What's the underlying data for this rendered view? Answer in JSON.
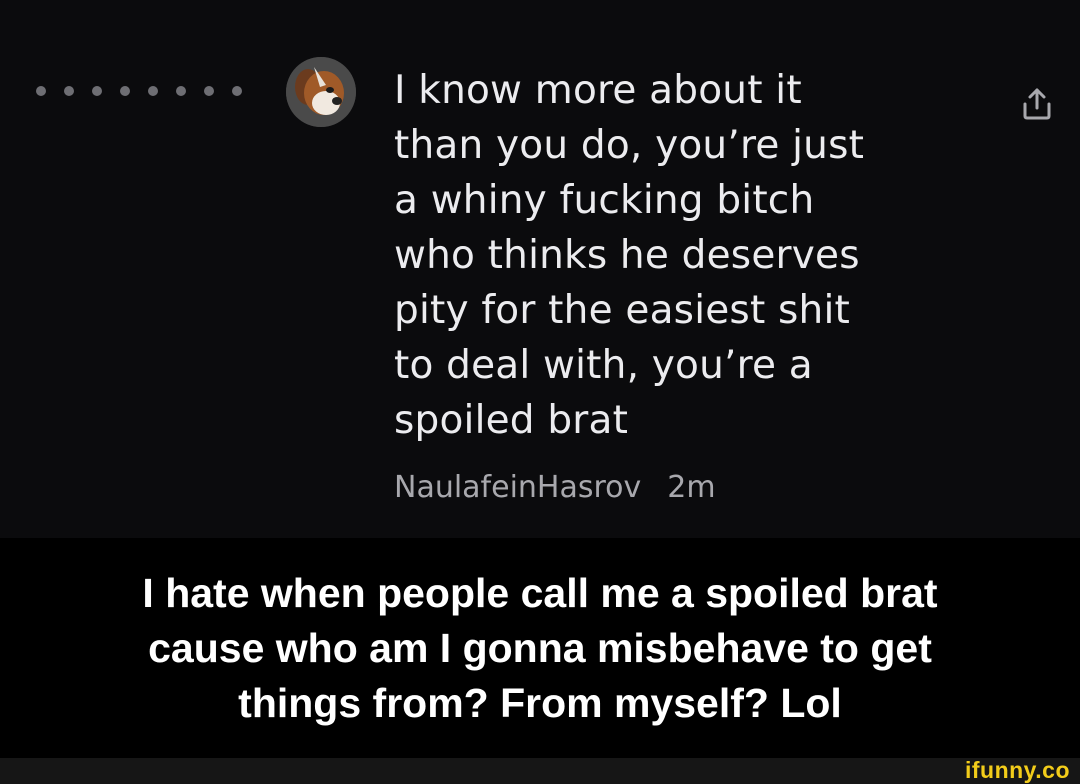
{
  "comment": {
    "lines": [
      "I know more about it",
      "than you do, you’re just",
      "a whiny fucking bitch",
      "who thinks he deserves",
      "pity for the easiest shit",
      "to deal with, you’re a",
      "spoiled brat"
    ],
    "username": "NaulafeinHasrov",
    "time": "2m",
    "avatar_icon": "dog-avatar-icon",
    "share_icon": "share-icon",
    "dots_icon": "thread-dots-icon"
  },
  "caption": {
    "lines": [
      "I hate when people call me a spoiled brat",
      "cause who am I gonna misbehave to get",
      "things from? From myself? Lol"
    ]
  },
  "watermark": {
    "text": "ifunny.co",
    "color": "#f2cc1a"
  },
  "colors": {
    "panel_background": "#0b0b0d",
    "page_background": "#000000",
    "comment_text": "#ececef",
    "meta_text": "#a8a8ad"
  }
}
